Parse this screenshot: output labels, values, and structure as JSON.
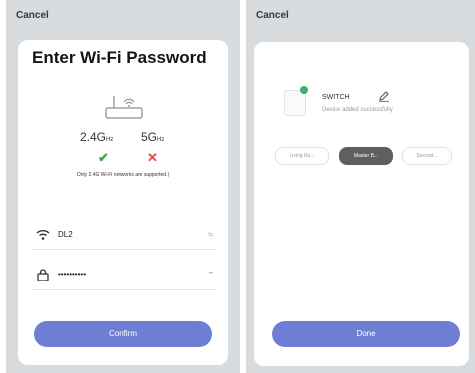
{
  "left_screen": {
    "cancel_label": "Cancel",
    "title": "Enter Wi-Fi Password",
    "band_24": "2.4G",
    "band_24_unit": "Hz",
    "band_5": "5G",
    "band_5_unit": "Hz",
    "band_24_status": "✔",
    "band_5_status": "✕",
    "note": "Only 2.4G Wi-Fi networks are supported.)",
    "ssid_value": "DL2",
    "ssid_trailing": "⇆",
    "password_value": "••••••••••",
    "password_trailing": "••",
    "confirm_label": "Confirm"
  },
  "right_screen": {
    "cancel_label": "Cancel",
    "device_name": "SWITCH",
    "device_status": "Device added successfully",
    "rooms": [
      "Living Ro...",
      "Master B...",
      "Second..."
    ],
    "selected_room_index": 1,
    "done_label": "Done"
  },
  "colors": {
    "primary": "#6e7fd3",
    "success": "#3aa84b",
    "error": "#e04a3f",
    "online_dot": "#34b36a"
  }
}
